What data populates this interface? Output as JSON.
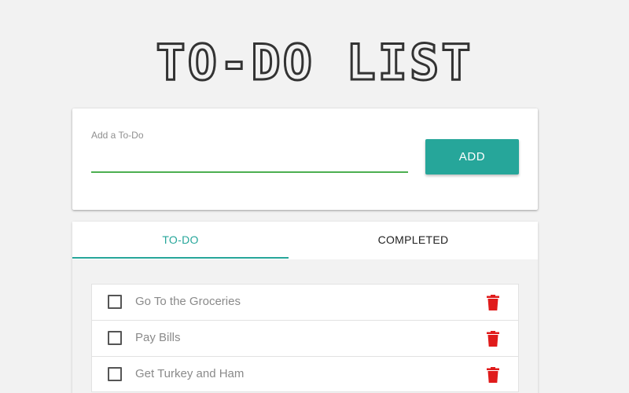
{
  "header": {
    "title": "TO-DO LIST"
  },
  "add_form": {
    "label": "Add a To-Do",
    "value": "",
    "button_label": "ADD"
  },
  "tabs": [
    {
      "label": "TO-DO",
      "active": true
    },
    {
      "label": "COMPLETED",
      "active": false
    }
  ],
  "todos": [
    {
      "text": "Go To the Groceries",
      "checked": false
    },
    {
      "text": "Pay Bills",
      "checked": false
    },
    {
      "text": "Get Turkey and Ham",
      "checked": false
    }
  ],
  "icons": {
    "delete": "trash-icon",
    "checkbox": "checkbox-icon"
  },
  "colors": {
    "accent": "#26a69a",
    "input_underline": "#4caf50",
    "delete": "#e01b1b",
    "background": "#f2f2f2",
    "title": "#333333"
  }
}
